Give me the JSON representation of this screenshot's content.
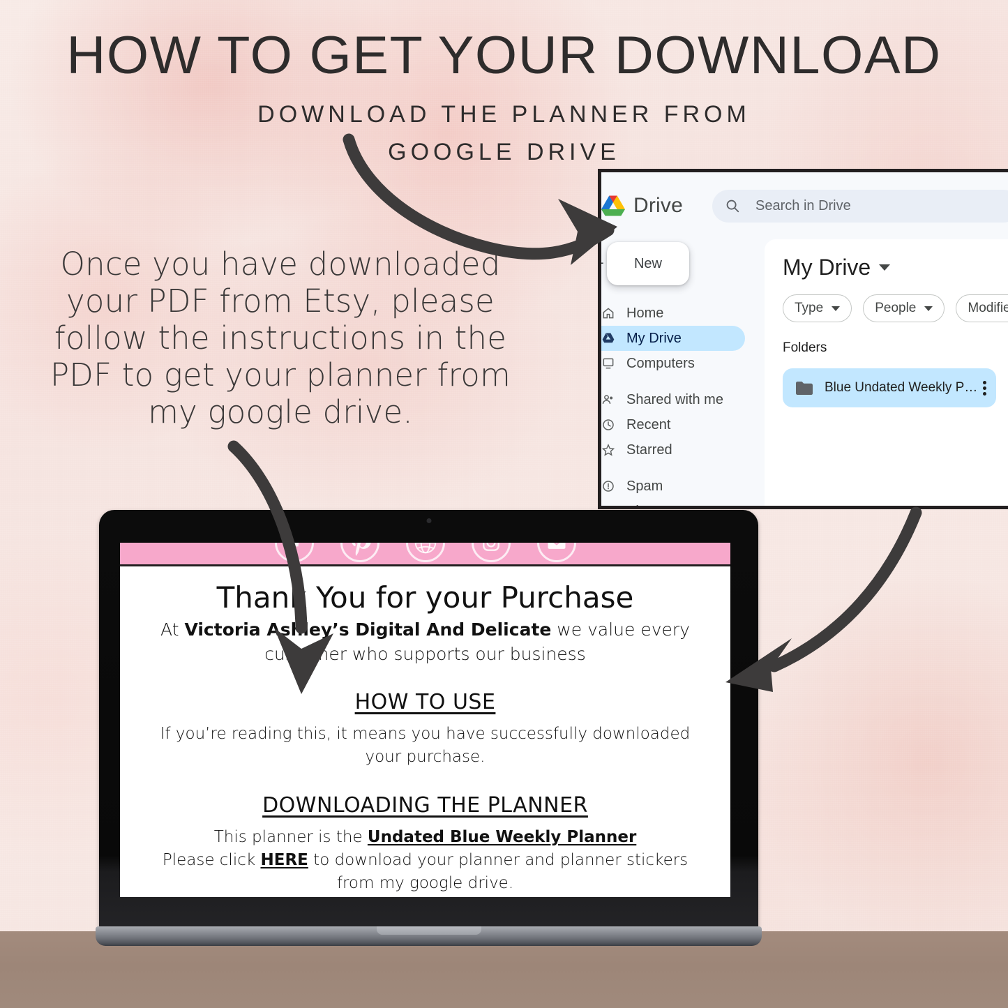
{
  "header": {
    "title": "HOW TO GET YOUR DOWNLOAD",
    "subtitle_line1": "DOWNLOAD THE PLANNER FROM",
    "subtitle_line2": "GOOGLE DRIVE"
  },
  "note": {
    "text": "Once you have downloaded your PDF from Etsy, please follow the instructions in the PDF to get your planner from my google drive."
  },
  "drive": {
    "brand": "Drive",
    "search_placeholder": "Search in Drive",
    "new_button": "New",
    "nav": [
      {
        "label": "Home",
        "icon": "home-icon",
        "active": false
      },
      {
        "label": "My Drive",
        "icon": "my-drive-icon",
        "active": true
      },
      {
        "label": "Computers",
        "icon": "computers-icon",
        "active": false
      },
      {
        "label": "Shared with me",
        "icon": "shared-with-me-icon",
        "active": false
      },
      {
        "label": "Recent",
        "icon": "clock-icon",
        "active": false
      },
      {
        "label": "Starred",
        "icon": "star-icon",
        "active": false
      },
      {
        "label": "Spam",
        "icon": "spam-icon",
        "active": false
      },
      {
        "label": "Bin",
        "icon": "trash-icon",
        "active": false
      }
    ],
    "breadcrumb": "My Drive",
    "chips": [
      "Type",
      "People",
      "Modified"
    ],
    "folders_label": "Folders",
    "folders": [
      {
        "name": "Blue Undated Weekly P…"
      }
    ]
  },
  "laptop": {
    "doc": {
      "title": "Thank You for your Purchase",
      "intro_prefix": "At ",
      "intro_brand": "Victoria Ashley’s Digital And Delicate",
      "intro_suffix": " we value every customer who supports our business",
      "section1_heading": "HOW TO USE",
      "section1_body": "If you’re reading this, it means you have successfully downloaded your purchase.",
      "section2_heading": "DOWNLOADING THE PLANNER",
      "section2_line1_prefix": "This planner is the ",
      "section2_line1_link": "Undated Blue Weekly Planner",
      "section2_line2_prefix": "Please click ",
      "section2_line2_link": "HERE",
      "section2_line2_suffix": " to download your planner and planner stickers from my google drive."
    },
    "social_icons": [
      "facebook-icon",
      "pinterest-icon",
      "globe-icon",
      "instagram-icon",
      "email-icon"
    ]
  },
  "colors": {
    "background_pink": "#f6e6e2",
    "accent_pink_bar": "#f7a8cb",
    "desk_brown": "#a08a7c",
    "drive_highlight_blue": "#c2e7ff",
    "ink": "#2e2c2c"
  }
}
